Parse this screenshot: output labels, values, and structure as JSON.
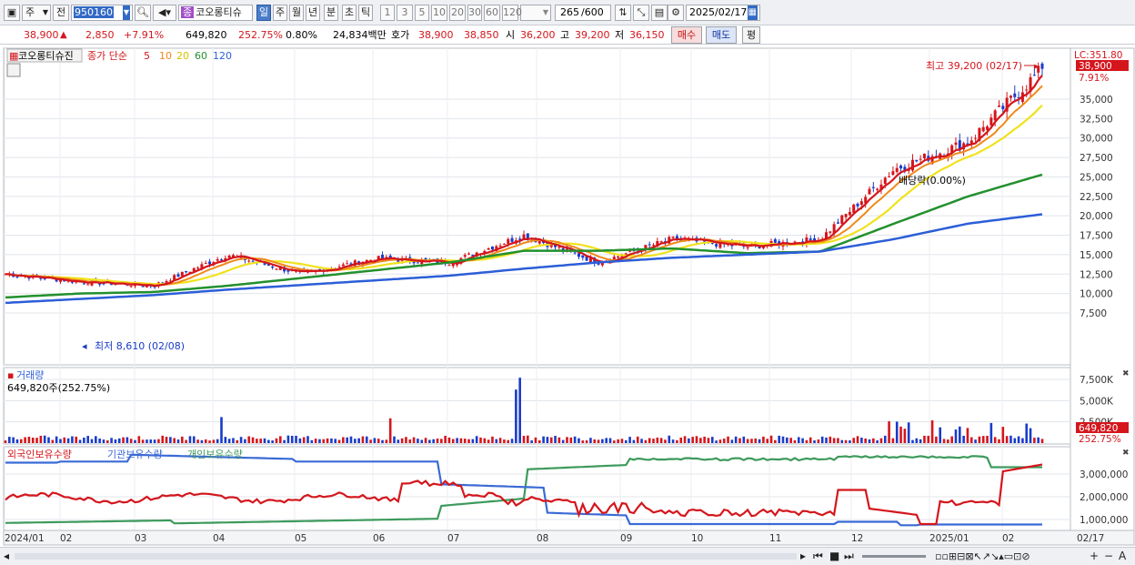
{
  "toolbar": {
    "type_label": "주",
    "mode_label": "전",
    "stock_code": "950160",
    "stock_badge": "종",
    "stock_name": "코오롱티슈",
    "periods": [
      "일",
      "주",
      "월",
      "년",
      "분",
      "초",
      "틱"
    ],
    "selected_period": "일",
    "intervals": [
      "1",
      "3",
      "5",
      "10",
      "20",
      "30",
      "60",
      "120"
    ],
    "count_value": "265",
    "count_total": "/600",
    "date_value": "2025/02/17"
  },
  "quote": {
    "price": "38,900",
    "change": "2,850",
    "change_pct": "+7.91%",
    "volume": "649,820",
    "volume_ratio": "252.75%",
    "turnover": "0.80%",
    "amount": "24,834백만",
    "ask_label": "호가",
    "ask": "38,900",
    "bid": "38,850",
    "open_label": "시",
    "open": "36,200",
    "high_label": "고",
    "high": "39,200",
    "low_label": "저",
    "low": "36,150",
    "buy_label": "매수",
    "sell_label": "매도",
    "avg_label": "평"
  },
  "price_panel": {
    "title": "코오롱티슈진",
    "ma_label": "종가 단순",
    "ma_periods": [
      "5",
      "10",
      "20",
      "60",
      "120"
    ],
    "lc_label": "LC:351.80",
    "current_label": "38,900",
    "change_label": "7.91%",
    "high_note": "최고 39,200 (02/17)",
    "low_note": "최저 8,610 (02/08)",
    "event_note": "배당락(0.00%)",
    "y_ticks": [
      "35,000",
      "32,500",
      "30,000",
      "27,500",
      "25,000",
      "22,500",
      "20,000",
      "17,500",
      "15,000",
      "12,500",
      "10,000",
      "7,500"
    ]
  },
  "volume_panel": {
    "title": "거래량",
    "value_label": "649,820주(252.75%)",
    "y_ticks": [
      "7,500K",
      "5,000K",
      "2,500K"
    ],
    "current_label": "649,820",
    "ratio_label": "252.75%"
  },
  "holdings_panel": {
    "legends": [
      "외국인보유수량",
      "기관보유수량",
      "개인보유수량"
    ],
    "y_ticks": [
      "3,000,000",
      "2,000,000",
      "1,000,000"
    ]
  },
  "x_axis": {
    "labels": [
      "2024/01",
      "02",
      "03",
      "04",
      "05",
      "06",
      "07",
      "08",
      "09",
      "10",
      "11",
      "12",
      "2025/01",
      "02"
    ],
    "end_label": "02/17"
  },
  "colors": {
    "up": "#d4161c",
    "down": "#1a3cc8",
    "ma5": "#d4161c",
    "ma10": "#ee8a1a",
    "ma20": "#f0e21c",
    "ma60": "#23902e",
    "ma120": "#2c5ed8",
    "foreign": "#d4161c",
    "institution": "#3a6ad6",
    "individual": "#3d9a5c"
  },
  "chart_data": {
    "type": "line",
    "title": "코오롱티슈진",
    "x": [
      "2024/01",
      "02",
      "03",
      "04",
      "05",
      "06",
      "07",
      "08",
      "09",
      "10",
      "11",
      "12",
      "2025/01",
      "02",
      "02/17"
    ],
    "series": [
      {
        "name": "5",
        "values": [
          12500,
          11500,
          11000,
          15000,
          12500,
          14500,
          14000,
          17500,
          14000,
          17000,
          16000,
          17000,
          26000,
          29500,
          38900
        ]
      },
      {
        "name": "60",
        "values": [
          9500,
          10000,
          10200,
          11000,
          12000,
          13000,
          14000,
          15500,
          15500,
          15800,
          15200,
          15400,
          19000,
          22500,
          25300
        ]
      },
      {
        "name": "120",
        "values": [
          8800,
          9300,
          9800,
          10500,
          11100,
          11700,
          12300,
          13200,
          14000,
          14600,
          15000,
          15400,
          17000,
          19000,
          20200
        ]
      }
    ],
    "high": 39200,
    "low": 8610,
    "ylim": [
      7500,
      39500
    ]
  }
}
